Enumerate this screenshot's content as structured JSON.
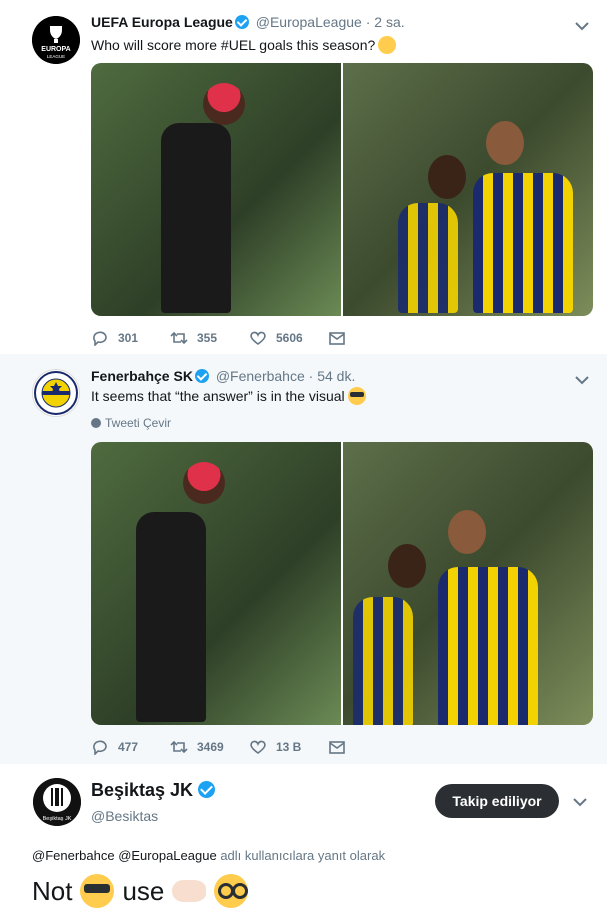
{
  "tweets": [
    {
      "name": "UEFA Europa League",
      "handle": "@EuropaLeague",
      "separator": "·",
      "time": "2 sa.",
      "text": "Who will score more #UEL goals this season?",
      "emoji": "thinking-face",
      "avatar_text": [
        "EUROPA",
        "LEAGUE"
      ],
      "actions": {
        "replies": "301",
        "retweets": "355",
        "likes": "5606"
      }
    },
    {
      "name": "Fenerbahçe SK",
      "handle": "@Fenerbahce",
      "separator": "·",
      "time": "54 dk.",
      "text": "It seems that “the answer” is in the visual",
      "emoji": "smiling-face-with-sunglasses",
      "translate_label": "Tweeti Çevir",
      "actions": {
        "replies": "477",
        "retweets": "3469",
        "likes": "13 B"
      }
    }
  ],
  "main_tweet": {
    "name": "Beşiktaş JK",
    "handle": "@Besiktas",
    "avatar_text": "Beşiktaş JK",
    "follow_label": "Takip ediliyor",
    "reply_to_mentions": "@Fenerbahce @EuropaLeague",
    "reply_to_suffix": "adlı kullanıcılara yanıt olarak",
    "text_parts": [
      "Not",
      "use"
    ],
    "emojis": [
      "smiling-face-with-sunglasses",
      "backhand-index-pointing-left",
      "nerd-face"
    ]
  },
  "colors": {
    "accent": "#1da1f2",
    "muted": "#657786",
    "thread_line": "#ccd6dd",
    "follow_button": "#2b2f33"
  }
}
